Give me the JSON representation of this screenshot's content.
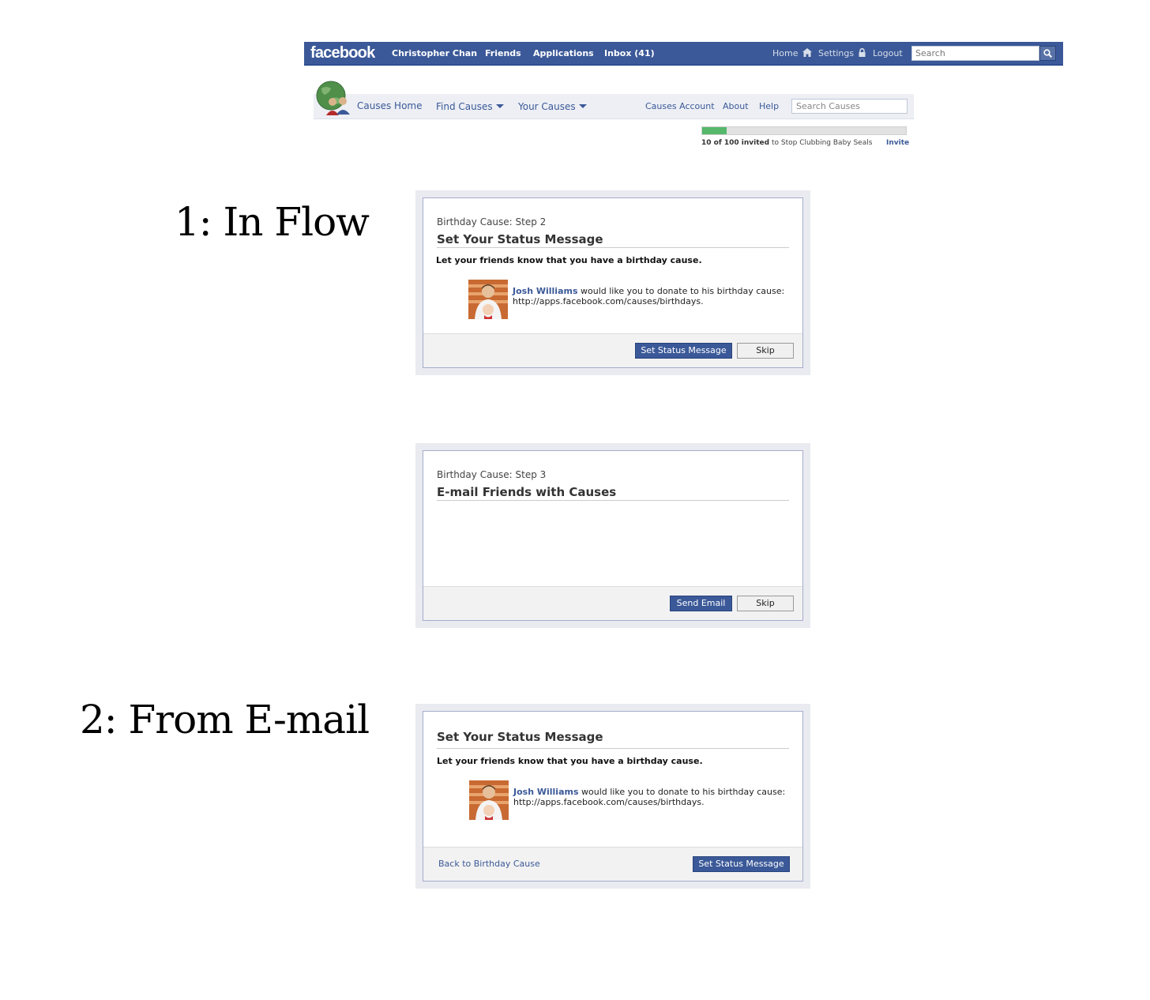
{
  "facebook_bar": {
    "logo": "facebook",
    "nav": [
      "Christopher Chan",
      "Friends",
      "Applications",
      "Inbox (41)"
    ],
    "right_links": {
      "home": "Home",
      "settings": "Settings",
      "logout": "Logout"
    },
    "search_placeholder": "Search",
    "brand_color": "#3b5998"
  },
  "causes_nav": {
    "home": "Causes Home",
    "find": "Find Causes",
    "yours": "Your Causes",
    "account": "Causes Account",
    "about": "About",
    "help": "Help",
    "search_placeholder": "Search Causes"
  },
  "invite_progress": {
    "invited": 10,
    "total": 100,
    "count_text": "10 of 100 invited",
    "rest_text": " to Stop Clubbing Baby Seals",
    "invite_label": "Invite",
    "fill_color": "#55b86b"
  },
  "sections": {
    "in_flow": "1: In Flow",
    "from_email": "2: From E-mail"
  },
  "dialog_step2": {
    "step": "Birthday Cause: Step 2",
    "title": "Set Your Status Message",
    "description": "Let your friends know that you have a birthday cause.",
    "story_name": "Josh Williams",
    "story_text_1": " would like you to donate to his birthday cause:",
    "story_text_2": "http://apps.facebook.com/causes/birthdays.",
    "primary_button": "Set Status Message",
    "skip_button": "Skip"
  },
  "dialog_step3": {
    "step": "Birthday Cause: Step 3",
    "title": "E-mail Friends with Causes",
    "primary_button": "Send Email",
    "skip_button": "Skip"
  },
  "dialog_email": {
    "title": "Set Your Status Message",
    "description": "Let your friends know that you have a birthday cause.",
    "story_name": "Josh Williams",
    "story_text_1": " would like you to donate to his birthday cause:",
    "story_text_2": "http://apps.facebook.com/causes/birthdays.",
    "back_link": "Back to Birthday Cause",
    "primary_button": "Set Status Message"
  }
}
